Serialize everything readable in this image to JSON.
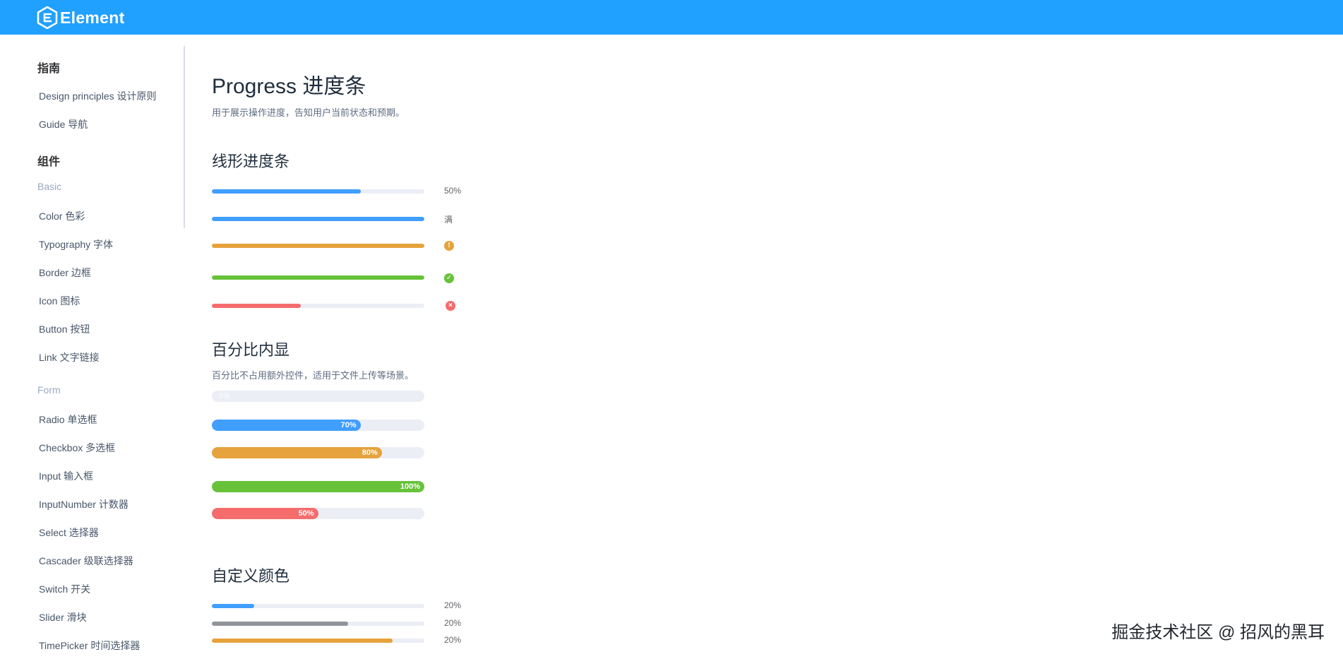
{
  "header": {
    "brand": "Element",
    "color": "#20a0ff"
  },
  "sidebar": {
    "groups": [
      {
        "label": "指南"
      },
      {
        "label": "组件"
      }
    ],
    "guide_items": [
      "Design principles  设计原则",
      "Guide 导航"
    ],
    "categories": [
      "Basic",
      "Form"
    ],
    "basic_items": [
      "Color 色彩",
      "Typography 字体",
      "Border 边框",
      "Icon 图标",
      "Button 按钮",
      "Link 文字链接"
    ],
    "form_items": [
      "Radio 单选框",
      "Checkbox 多选框",
      "Input 输入框",
      "InputNumber 计数器",
      "Select 选择器",
      "Cascader 级联选择器",
      "Switch 开关",
      "Slider 滑块",
      "TimePicker 时间选择器"
    ]
  },
  "page": {
    "title": "Progress 进度条",
    "description": "用于展示操作进度，告知用户当前状态和预期。",
    "sections": {
      "linear": {
        "title": "线形进度条"
      },
      "inside": {
        "title": "百分比内显",
        "description": "百分比不占用额外控件，适用于文件上传等场景。"
      },
      "custom": {
        "title": "自定义颜色"
      }
    }
  },
  "linear_bars": [
    {
      "percent": 70,
      "label": "50%",
      "status": "none",
      "color": "#409eff"
    },
    {
      "percent": 100,
      "label": "满",
      "status": "none",
      "color": "#409eff"
    },
    {
      "percent": 100,
      "label": "",
      "status": "warning",
      "color": "#e6a23c"
    },
    {
      "percent": 100,
      "label": "",
      "status": "success",
      "color": "#67c23a"
    },
    {
      "percent": 42,
      "label": "",
      "status": "exception",
      "color": "#f56c6c"
    }
  ],
  "inside_bars": [
    {
      "percent": 0,
      "label": "0%",
      "color": "#409eff"
    },
    {
      "percent": 70,
      "label": "70%",
      "color": "#409eff"
    },
    {
      "percent": 80,
      "label": "80%",
      "color": "#e6a23c"
    },
    {
      "percent": 100,
      "label": "100%",
      "color": "#67c23a"
    },
    {
      "percent": 50,
      "label": "50%",
      "color": "#f56c6c"
    }
  ],
  "custom_bars": [
    {
      "percent": 20,
      "label": "20%",
      "color": "#409eff"
    },
    {
      "percent": 64,
      "label": "20%",
      "color": "#909399"
    },
    {
      "percent": 85,
      "label": "20%",
      "color": "#e6a23c"
    }
  ],
  "status_icons": {
    "warning": "!",
    "success": "✓",
    "exception": "×"
  },
  "watermark": "掘金技术社区 @ 招风的黑耳"
}
